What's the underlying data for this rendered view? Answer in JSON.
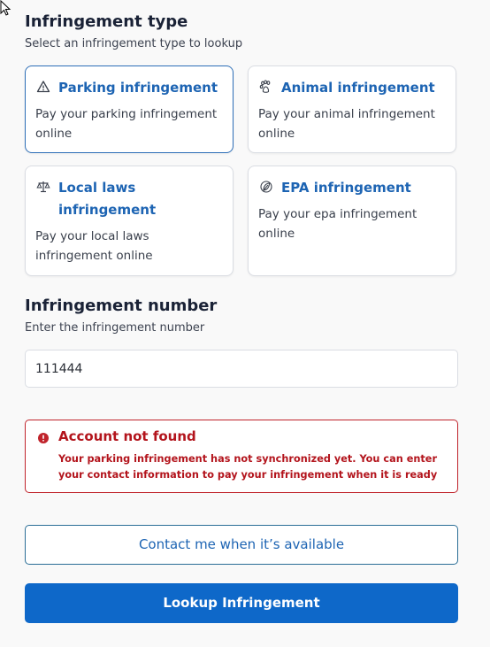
{
  "type_section": {
    "title": "Infringement type",
    "subtitle": "Select an infringement type to lookup"
  },
  "cards": [
    {
      "title": "Parking infringement",
      "description": "Pay your parking infringement online",
      "icon": "warning-triangle-icon",
      "selected": true
    },
    {
      "title": "Animal infringement",
      "description": "Pay your animal infringement online",
      "icon": "paw-icon",
      "selected": false
    },
    {
      "title": "Local laws infringement",
      "description": "Pay your local laws infringement online",
      "icon": "scales-icon",
      "selected": false
    },
    {
      "title": "EPA infringement",
      "description": "Pay your epa infringement online",
      "icon": "leaf-icon",
      "selected": false
    }
  ],
  "number_section": {
    "title": "Infringement number",
    "subtitle": "Enter the infringement number",
    "value": "111444"
  },
  "alert": {
    "title": "Account not found",
    "body": "Your parking infringement has not synchronized yet. You can enter your contact information to pay your infringement when it is ready"
  },
  "buttons": {
    "contact": "Contact me when it’s available",
    "lookup": "Lookup Infringement"
  },
  "colors": {
    "accent": "#1d64b3",
    "primary_button": "#0e68c9",
    "error": "#b3141c",
    "background": "#f9f9f9"
  }
}
